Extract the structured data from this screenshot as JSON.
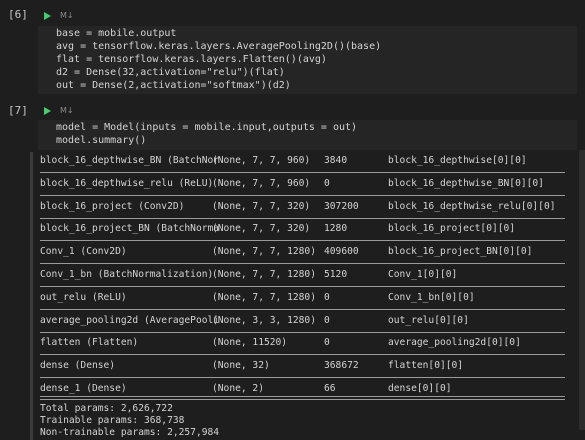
{
  "cells": [
    {
      "exec_count": "[6]",
      "badge": "M↓",
      "lines": [
        "base = mobile.output",
        "avg = tensorflow.keras.layers.AveragePooling2D()(base)",
        "flat = tensorflow.keras.layers.Flatten()(avg)",
        "d2 = Dense(32,activation=\"relu\")(flat)",
        "out = Dense(2,activation=\"softmax\")(d2)"
      ]
    },
    {
      "exec_count": "[7]",
      "badge": "M↓",
      "lines": [
        "model = Model(inputs = mobile.input,outputs = out)",
        "model.summary()"
      ]
    }
  ],
  "summary_rows": [
    [
      "block_16_depthwise_BN (BatchNor",
      "(None, 7, 7, 960)",
      "3840",
      "block_16_depthwise[0][0]"
    ],
    [
      "block_16_depthwise_relu (ReLU)",
      "(None, 7, 7, 960)",
      "0",
      "block_16_depthwise_BN[0][0]"
    ],
    [
      "block_16_project (Conv2D)",
      "(None, 7, 7, 320)",
      "307200",
      "block_16_depthwise_relu[0][0]"
    ],
    [
      "block_16_project_BN (BatchNorma",
      "(None, 7, 7, 320)",
      "1280",
      "block_16_project[0][0]"
    ],
    [
      "Conv_1 (Conv2D)",
      "(None, 7, 7, 1280)",
      "409600",
      "block_16_project_BN[0][0]"
    ],
    [
      "Conv_1_bn (BatchNormalization)",
      "(None, 7, 7, 1280)",
      "5120",
      "Conv_1[0][0]"
    ],
    [
      "out_relu (ReLU)",
      "(None, 7, 7, 1280)",
      "0",
      "Conv_1_bn[0][0]"
    ],
    [
      "average_pooling2d (AveragePooli",
      "(None, 3, 3, 1280)",
      "0",
      "out_relu[0][0]"
    ],
    [
      "flatten (Flatten)",
      "(None, 11520)",
      "0",
      "average_pooling2d[0][0]"
    ],
    [
      "dense (Dense)",
      "(None, 32)",
      "368672",
      "flatten[0][0]"
    ],
    [
      "dense_1 (Dense)",
      "(None, 2)",
      "66",
      "dense[0][0]"
    ]
  ],
  "totals": {
    "total": "Total params: 2,626,722",
    "trainable": "Trainable params: 368,738",
    "non_trainable": "Non-trainable params: 2,257,984"
  }
}
